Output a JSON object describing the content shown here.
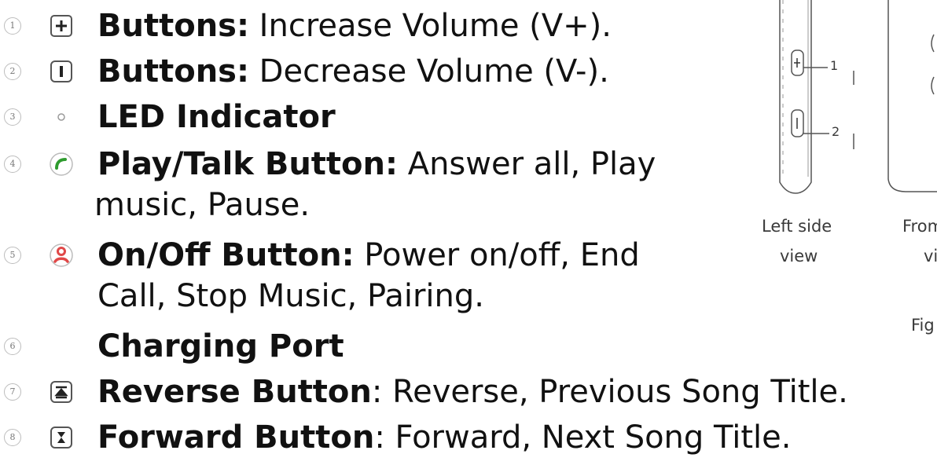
{
  "items": [
    {
      "number": "1",
      "icon": "plus-button-icon",
      "label": "Buttons:",
      "text": " Increase Volume (V+)."
    },
    {
      "number": "2",
      "icon": "minus-button-icon",
      "label": "Buttons:",
      "text": " Decrease Volume (V-)."
    },
    {
      "number": "3",
      "icon": "led-indicator-icon",
      "label": "LED Indicator",
      "text": ""
    },
    {
      "number": "4",
      "icon": "green-phone-icon",
      "label": "Play/Talk Button:",
      "text": " Answer all, Play",
      "cont": "music, Pause."
    },
    {
      "number": "5",
      "icon": "red-phone-person-icon",
      "label": "On/Off Button:",
      "text": " Power on/off, End",
      "cont": "Call, Stop Music, Pairing."
    },
    {
      "number": "6",
      "icon": "",
      "label": "Charging Port",
      "text": ""
    },
    {
      "number": "7",
      "icon": "reverse-button-icon",
      "label": "Reverse Button",
      "text": ": Reverse, Previous Song Title."
    },
    {
      "number": "8",
      "icon": "forward-button-icon",
      "label": "Forward Button",
      "text": ": Forward, Next Song Title."
    }
  ],
  "figure": {
    "callouts": [
      "1",
      "2"
    ],
    "caption_left_line1": "Left side",
    "caption_left_line2": "view",
    "caption_front_line1": "From",
    "caption_front_line2": "vi",
    "caption_fig": "Fig"
  },
  "colors": {
    "text": "#111111",
    "green": "#2e9b2e",
    "red": "#e04848",
    "outline": "#555555"
  }
}
